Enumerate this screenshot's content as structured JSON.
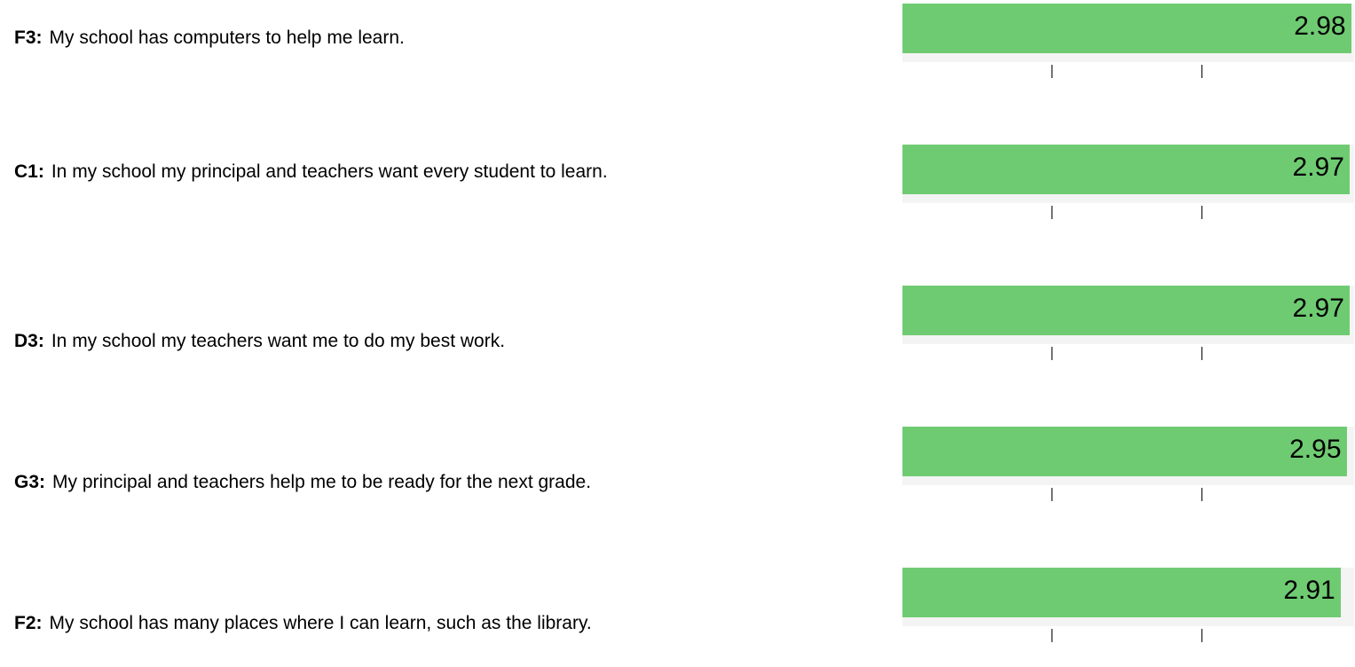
{
  "colors": {
    "bar": "#6fcb72",
    "track": "#f4f4f4",
    "text": "#000000"
  },
  "chart_data": {
    "type": "bar",
    "orientation": "horizontal",
    "xlim": [
      0,
      3
    ],
    "grid": false,
    "categories": [
      "F3: My school has computers to help me learn.",
      "C1: In my school my principal and teachers want every student to learn.",
      "D3: In my school my teachers want me to do my best work.",
      "G3: My principal and teachers help me to be ready for the next grade.",
      "F2: My school has many places where I can learn, such as the library."
    ],
    "items": [
      {
        "code": "F3:",
        "text": "My school has computers to help me learn.",
        "value": 2.98,
        "value_label": "2.98"
      },
      {
        "code": "C1:",
        "text": "In my school my principal and teachers want every student to learn.",
        "value": 2.97,
        "value_label": "2.97"
      },
      {
        "code": "D3:",
        "text": "In my school my teachers want me to do my best work.",
        "value": 2.97,
        "value_label": "2.97"
      },
      {
        "code": "G3:",
        "text": "My principal and teachers help me to be ready for the next grade.",
        "value": 2.95,
        "value_label": "2.95"
      },
      {
        "code": "F2:",
        "text": "My school has many places where I can learn, such as the library.",
        "value": 2.91,
        "value_label": "2.91"
      }
    ],
    "values": [
      2.98,
      2.97,
      2.97,
      2.95,
      2.91
    ],
    "tick_values": [
      1,
      2
    ]
  }
}
